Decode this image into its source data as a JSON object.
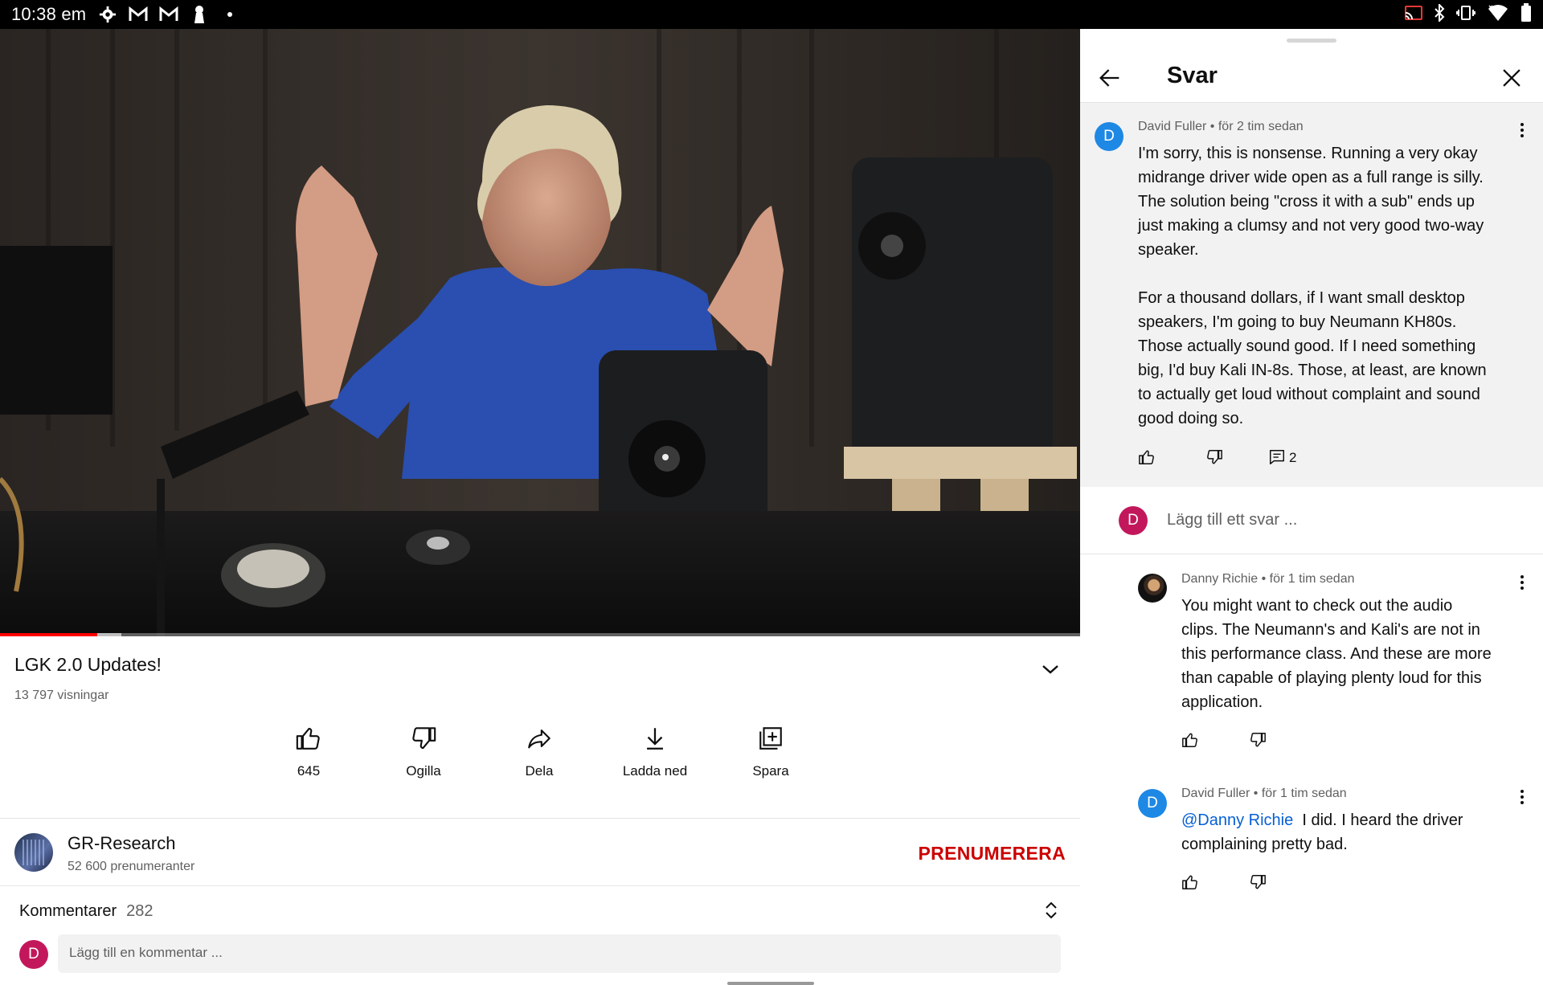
{
  "status_bar": {
    "time": "10:38 em",
    "left_icons": [
      "settings-gear-icon",
      "gmail-icon",
      "gmail-icon",
      "keyhole-icon",
      "dot-icon"
    ],
    "right_icons": [
      "cast-icon",
      "bluetooth-icon",
      "vibrate-icon",
      "wifi-icon",
      "battery-icon"
    ]
  },
  "video": {
    "title": "LGK 2.0 Updates!",
    "views": "13 797 visningar",
    "progress_fraction": 0.09,
    "actions": [
      {
        "name": "like",
        "label": "645",
        "icon": "thumb-up-icon"
      },
      {
        "name": "dislike",
        "label": "Ogilla",
        "icon": "thumb-down-icon"
      },
      {
        "name": "share",
        "label": "Dela",
        "icon": "share-icon"
      },
      {
        "name": "download",
        "label": "Ladda ned",
        "icon": "download-icon"
      },
      {
        "name": "save",
        "label": "Spara",
        "icon": "add-to-playlist-icon"
      }
    ]
  },
  "channel": {
    "name": "GR-Research",
    "subscribers": "52 600 prenumeranter",
    "subscribe_label": "PRENUMERERA"
  },
  "comments": {
    "label": "Kommentarer",
    "count": "282",
    "user_initial": "D",
    "add_placeholder": "Lägg till en kommentar ..."
  },
  "replies_panel": {
    "title": "Svar",
    "parent": {
      "author": "David Fuller",
      "time": "för 2 tim sedan",
      "initial": "D",
      "paragraph1": [
        "I'm sorry, this is nonsense. Running a very okay",
        "midrange driver wide open as a full range is silly.",
        "The solution being \"cross it with a sub\" ends up",
        "just making a clumsy and not very good two-way",
        "speaker."
      ],
      "paragraph2": [
        "For a thousand dollars, if I want small desktop",
        "speakers, I'm going to buy Neumann KH80s.",
        "Those actually sound good. If I need something",
        "big, I'd buy Kali IN-8s. Those, at least, are known",
        "to actually get loud without complaint and sound",
        "good doing so."
      ],
      "reply_count": "2"
    },
    "reply_input": {
      "initial": "D",
      "placeholder": "Lägg till ett svar ..."
    },
    "replies": [
      {
        "author": "Danny Richie",
        "time": "för 1 tim sedan",
        "lines": [
          "You might want to check out the audio",
          "clips. The Neumann's and Kali's are not in",
          "this performance class. And these are more",
          "than capable of playing plenty loud for this",
          "application."
        ]
      },
      {
        "author": "David Fuller",
        "time": "för 1 tim sedan",
        "initial": "D",
        "mention": "@Danny Richie",
        "line1_rest": "  I did. I heard the driver",
        "line2": "complaining pretty bad."
      }
    ]
  },
  "colors": {
    "brand_red": "#cc0000",
    "progress_red": "#ff0000",
    "link_blue": "#065fd4",
    "avatar_blue": "#1e88e5",
    "avatar_pink": "#c2185b"
  }
}
